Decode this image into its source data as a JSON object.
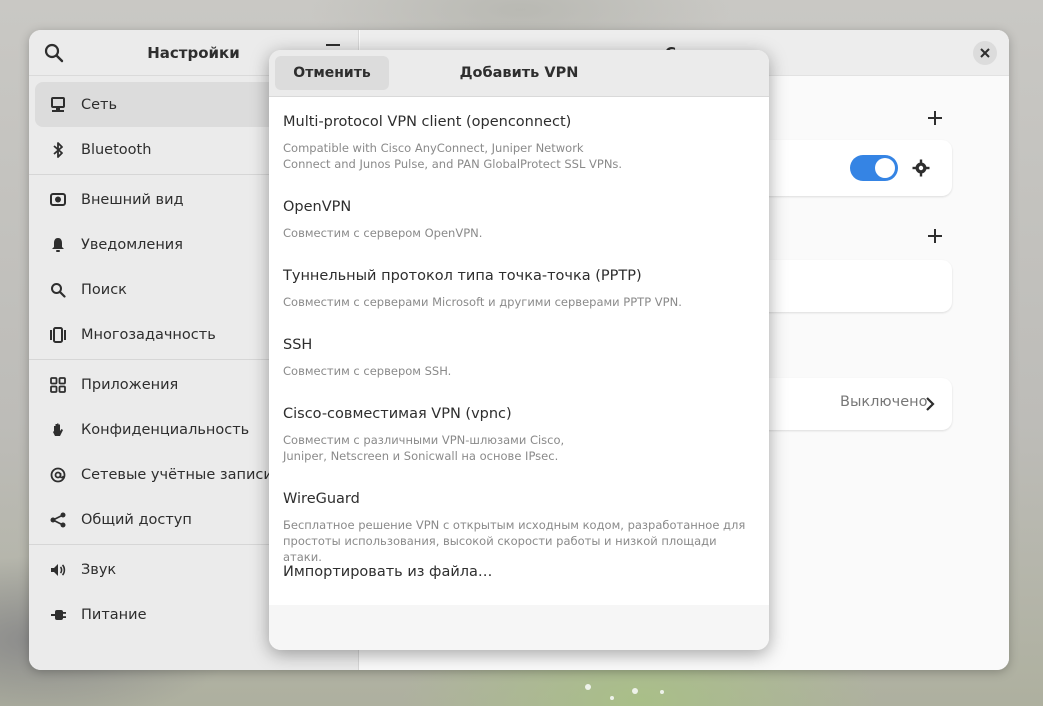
{
  "sidebar": {
    "title": "Настройки",
    "items": [
      {
        "label": "Сеть",
        "icon": "network-icon",
        "active": true
      },
      {
        "label": "Bluetooth",
        "icon": "bluetooth-icon"
      },
      {
        "label": "Внешний вид",
        "icon": "appearance-icon"
      },
      {
        "label": "Уведомления",
        "icon": "bell-icon"
      },
      {
        "label": "Поиск",
        "icon": "search-icon"
      },
      {
        "label": "Многозадачность",
        "icon": "multitasking-icon"
      },
      {
        "label": "Приложения",
        "icon": "apps-grid-icon"
      },
      {
        "label": "Конфиденциальность",
        "icon": "hand-icon"
      },
      {
        "label": "Сетевые учётные записи",
        "icon": "at-icon"
      },
      {
        "label": "Общий доступ",
        "icon": "share-icon"
      },
      {
        "label": "Звук",
        "icon": "speaker-icon"
      },
      {
        "label": "Питание",
        "icon": "power-plug-icon"
      }
    ]
  },
  "content": {
    "header_title": "С",
    "proxy_value": "Выключено"
  },
  "dialog": {
    "title": "Добавить VPN",
    "cancel_label": "Отменить",
    "options": [
      {
        "name": "Multi-protocol VPN client (openconnect)",
        "desc": "Compatible with Cisco AnyConnect, Juniper Network\nConnect and Junos Pulse, and PAN GlobalProtect SSL VPNs."
      },
      {
        "name": "OpenVPN",
        "desc": "Совместим с сервером OpenVPN."
      },
      {
        "name": "Туннельный протокол типа точка-точка (PPTP)",
        "desc": "Совместим с серверами Microsoft и другими серверами PPTP VPN."
      },
      {
        "name": "SSH",
        "desc": "Совместим с сервером SSH."
      },
      {
        "name": "Cisco-совместимая VPN (vpnc)",
        "desc": "Совместим с различными VPN-шлюзами Cisco,\nJuniper, Netscreen и Sonicwall на основе IPsec."
      },
      {
        "name": "WireGuard",
        "desc": "Бесплатное решение VPN с открытым исходным кодом, разработанное для\nпростоты использования, высокой скорости работы и низкой площади атаки."
      }
    ],
    "import_label": "Импортировать из файла…"
  },
  "colors": {
    "accent": "#3584e4",
    "sidebar_bg": "#ebebeb",
    "dialog_bg": "#fafafa"
  }
}
